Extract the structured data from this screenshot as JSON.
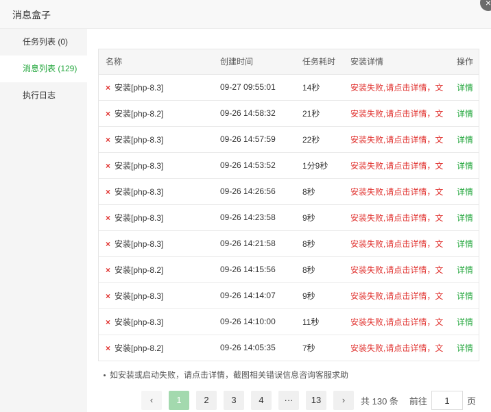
{
  "window": {
    "title": "消息盒子",
    "close_glyph": "×"
  },
  "sidebar": {
    "items": [
      {
        "label": "任务列表 (0)",
        "active": false
      },
      {
        "label": "消息列表 (129)",
        "active": true
      },
      {
        "label": "执行日志",
        "active": false
      }
    ]
  },
  "table": {
    "columns": [
      "名称",
      "创建时间",
      "任务耗时",
      "安装详情",
      "操作"
    ],
    "rows": [
      {
        "name": "安装[php-8.3]",
        "time": "09-27 09:55:01",
        "duration": "14秒",
        "detail": "安装失败,请点击详情，文",
        "action": "详情"
      },
      {
        "name": "安装[php-8.2]",
        "time": "09-26 14:58:32",
        "duration": "21秒",
        "detail": "安装失败,请点击详情，文",
        "action": "详情"
      },
      {
        "name": "安装[php-8.3]",
        "time": "09-26 14:57:59",
        "duration": "22秒",
        "detail": "安装失败,请点击详情，文",
        "action": "详情"
      },
      {
        "name": "安装[php-8.3]",
        "time": "09-26 14:53:52",
        "duration": "1分9秒",
        "detail": "安装失败,请点击详情，文",
        "action": "详情"
      },
      {
        "name": "安装[php-8.3]",
        "time": "09-26 14:26:56",
        "duration": "8秒",
        "detail": "安装失败,请点击详情，文",
        "action": "详情"
      },
      {
        "name": "安装[php-8.3]",
        "time": "09-26 14:23:58",
        "duration": "9秒",
        "detail": "安装失败,请点击详情，文",
        "action": "详情"
      },
      {
        "name": "安装[php-8.3]",
        "time": "09-26 14:21:58",
        "duration": "8秒",
        "detail": "安装失败,请点击详情，文",
        "action": "详情"
      },
      {
        "name": "安装[php-8.2]",
        "time": "09-26 14:15:56",
        "duration": "8秒",
        "detail": "安装失败,请点击详情，文",
        "action": "详情"
      },
      {
        "name": "安装[php-8.3]",
        "time": "09-26 14:14:07",
        "duration": "9秒",
        "detail": "安装失败,请点击详情，文",
        "action": "详情"
      },
      {
        "name": "安装[php-8.3]",
        "time": "09-26 14:10:00",
        "duration": "11秒",
        "detail": "安装失败,请点击详情，文",
        "action": "详情"
      },
      {
        "name": "安装[php-8.2]",
        "time": "09-26 14:05:35",
        "duration": "7秒",
        "detail": "安装失败,请点击详情，文",
        "action": "详情"
      }
    ],
    "status_icon": "×"
  },
  "tip": "如安装或启动失败，请点击详情，截图相关错误信息咨询客服求助",
  "pager": {
    "prev": "‹",
    "pages": [
      "1",
      "2",
      "3",
      "4",
      "···",
      "13"
    ],
    "current": "1",
    "next": "›",
    "total_text": "共 130 条",
    "goto_label": "前往",
    "goto_value": "1",
    "goto_unit": "页"
  },
  "colors": {
    "accent": "#20a53a",
    "error": "#e0302d",
    "active_page": "#a3d9ae"
  }
}
